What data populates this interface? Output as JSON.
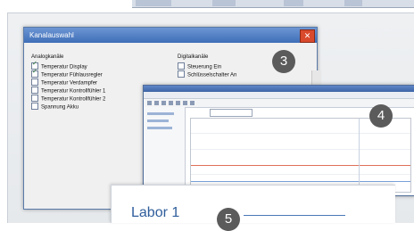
{
  "dialog": {
    "title": "Kanalauswahl",
    "close_glyph": "✕",
    "analog_header": "Analogkanäle",
    "digital_header": "Digitalkanäle",
    "analog_items": [
      {
        "label": "Temperatur Display",
        "checked": true
      },
      {
        "label": "Temperatur Fühlausregler",
        "checked": true
      },
      {
        "label": "Temperatur Verdampfer",
        "checked": false
      },
      {
        "label": "Temperatur Kontrollfühler 1",
        "checked": false
      },
      {
        "label": "Temperatur Kontrollfühler 2",
        "checked": false
      },
      {
        "label": "Spannung Akku",
        "checked": false
      }
    ],
    "digital_items": [
      {
        "label": "Steuerung Ein",
        "checked": false
      },
      {
        "label": "Schlüsselschalter An",
        "checked": false
      }
    ]
  },
  "badges": {
    "b3": "3",
    "b4": "4",
    "b5": "5"
  },
  "labor": {
    "title": "Labor 1"
  },
  "colors": {
    "accent": "#2f5d9b",
    "badge": "#5b5b5b",
    "close": "#d9492c"
  }
}
